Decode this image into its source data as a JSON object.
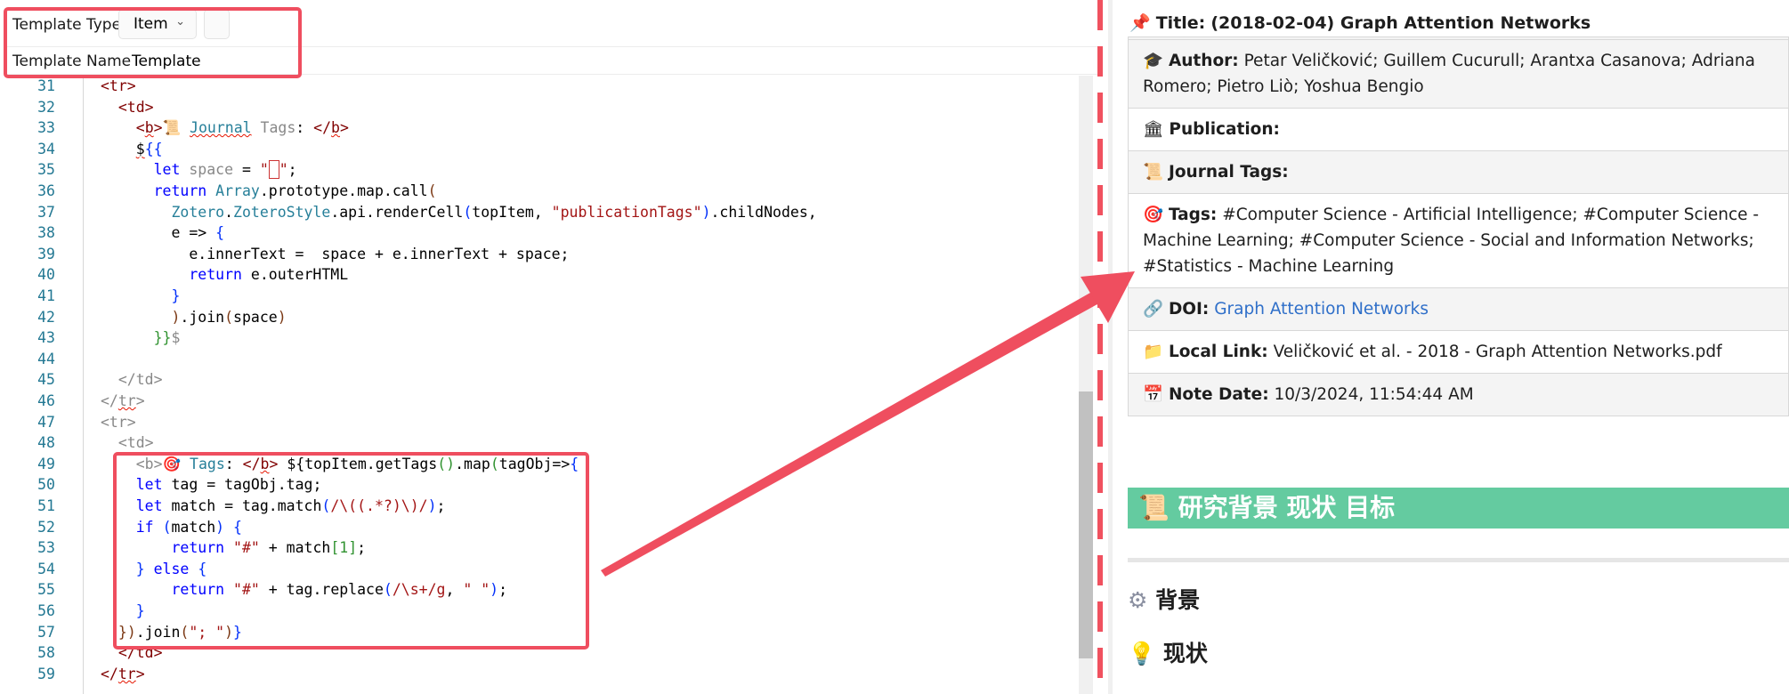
{
  "toolbar": {
    "template_type_label": "Template Type",
    "template_type_value": "Item",
    "template_name_label": "Template Name",
    "template_name_value": "Template"
  },
  "editor": {
    "line_numbers": [
      "31",
      "32",
      "33",
      "34",
      "35",
      "36",
      "37",
      "38",
      "39",
      "40",
      "41",
      "42",
      "43",
      "44",
      "45",
      "46",
      "47",
      "48",
      "49",
      "50",
      "51",
      "52",
      "53",
      "54",
      "55",
      "56",
      "57",
      "58",
      "59"
    ]
  },
  "preview": {
    "title_label": "Title:",
    "title_value": "(2018-02-04) Graph Attention Networks",
    "rows": [
      {
        "icon": "🎓",
        "label": "Author:",
        "value": "Petar Veličković; Guillem Cucurull; Arantxa Casanova; Adriana Romero; Pietro Liò; Yoshua Bengio"
      },
      {
        "icon": "🏛",
        "label": "Publication:",
        "value": ""
      },
      {
        "icon": "📜",
        "label": "Journal Tags:",
        "value": ""
      },
      {
        "icon": "🎯",
        "label": "Tags:",
        "value": "#Computer Science - Artificial Intelligence; #Computer Science - Machine Learning; #Computer Science - Social and Information Networks; #Statistics - Machine Learning"
      },
      {
        "icon": "🔗",
        "label": "DOI:",
        "value": "Graph Attention Networks"
      },
      {
        "icon": "📁",
        "label": "Local Link:",
        "value": "Veličković et al. - 2018 - Graph Attention Networks.pdf"
      },
      {
        "icon": "📅",
        "label": "Note Date:",
        "value": "10/3/2024, 11:54:44 AM"
      }
    ],
    "section_heading": "研究背景 现状 目标",
    "subheading_1": "背景",
    "subheading_2": "现状"
  },
  "colors": {
    "annotation": "#ef4e5f",
    "section_banner": "#64cba0",
    "link": "#2f6fc9"
  }
}
